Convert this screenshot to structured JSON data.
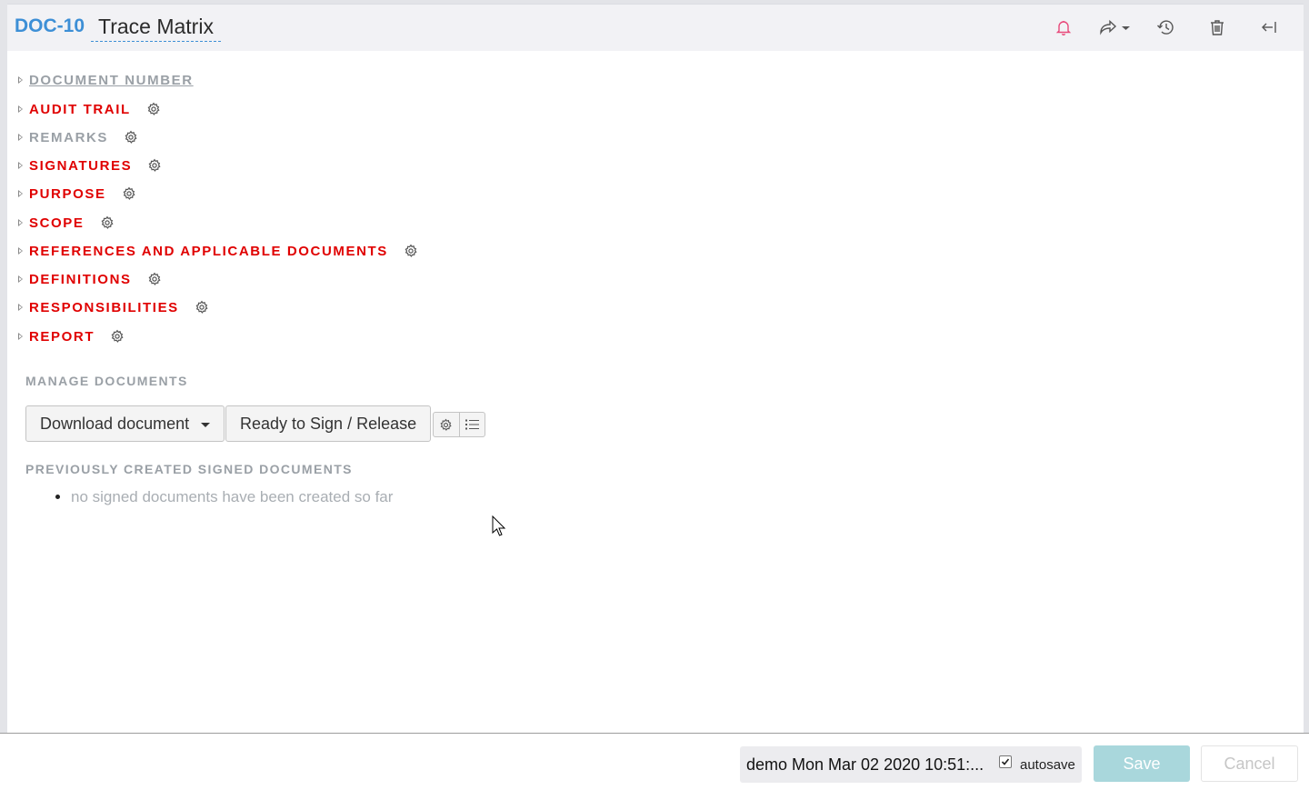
{
  "header": {
    "doc_id": "DOC-10",
    "title": "Trace Matrix",
    "icons": [
      "bell-icon",
      "share-icon",
      "history-icon",
      "trash-icon",
      "collapse-icon"
    ]
  },
  "sections": [
    {
      "label": "DOCUMENT NUMBER",
      "state": "link",
      "has_gear": false
    },
    {
      "label": "AUDIT TRAIL",
      "state": "required",
      "has_gear": true
    },
    {
      "label": "REMARKS",
      "state": "optional",
      "has_gear": true
    },
    {
      "label": "SIGNATURES",
      "state": "required",
      "has_gear": true
    },
    {
      "label": "PURPOSE",
      "state": "required",
      "has_gear": true
    },
    {
      "label": "SCOPE",
      "state": "required",
      "has_gear": true
    },
    {
      "label": "REFERENCES AND APPLICABLE DOCUMENTS",
      "state": "required",
      "has_gear": true
    },
    {
      "label": "DEFINITIONS",
      "state": "required",
      "has_gear": true
    },
    {
      "label": "RESPONSIBILITIES",
      "state": "required",
      "has_gear": true
    },
    {
      "label": "REPORT",
      "state": "required",
      "has_gear": true
    }
  ],
  "manage": {
    "title": "MANAGE DOCUMENTS",
    "download_label": "Download document",
    "release_label": "Ready to Sign / Release"
  },
  "previous": {
    "title": "PREVIOUSLY CREATED SIGNED DOCUMENTS",
    "empty_text": "no signed documents have been created so far"
  },
  "footer": {
    "status": "demo Mon Mar 02 2020 10:51:...",
    "autosave_label": "autosave",
    "autosave_checked": true,
    "save_label": "Save",
    "cancel_label": "Cancel"
  },
  "colors": {
    "accent": "#3d8fd6",
    "required": "#e00000",
    "muted": "#9aa0a6",
    "bell": "#e8497a",
    "save_bg": "#a9d7dc"
  }
}
